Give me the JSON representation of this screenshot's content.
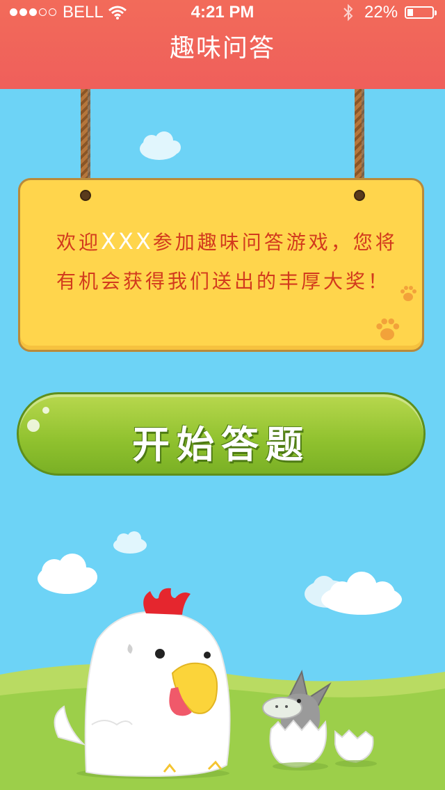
{
  "status_bar": {
    "carrier": "BELL",
    "time": "4:21 PM",
    "battery": "22%",
    "signal_strength": 3,
    "signal_max": 5
  },
  "header": {
    "title": "趣味问答"
  },
  "sign": {
    "text_before": "欢迎",
    "player_name": "XXX",
    "text_after": "参加趣味问答游戏，您将有机会获得我们送出的丰厚大奖！"
  },
  "start_button": {
    "label": "开始答题"
  },
  "colors": {
    "header": "#ef5f5b",
    "sky": "#6dd3f6",
    "sign": "#ffd54c",
    "sign_text": "#d23a1d",
    "button": "#8fc12e",
    "grass": "#9ccf4a"
  },
  "icons": [
    "wifi-icon",
    "bluetooth-icon",
    "battery-icon",
    "paw-icon"
  ]
}
